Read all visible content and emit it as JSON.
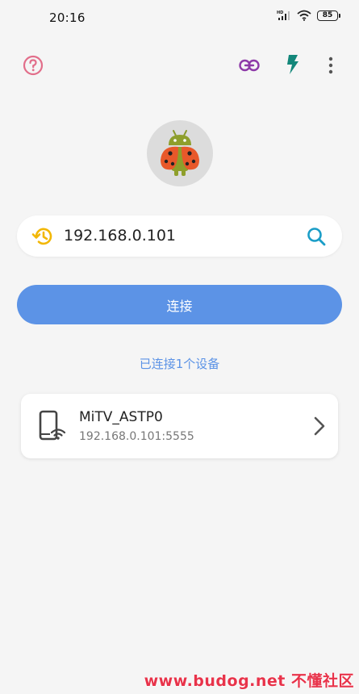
{
  "status_bar": {
    "time": "20:16",
    "network_badge": "HD",
    "battery": "85"
  },
  "toolbar": {
    "icons": [
      "help-icon",
      "link-icon",
      "flash-icon",
      "more-icon"
    ],
    "colors": {
      "help": "#e26e8a",
      "link": "#8e3aa8",
      "flash": "#13877a",
      "more": "#555555"
    }
  },
  "address": {
    "value": "192.168.0.101",
    "icon_left": "history-icon",
    "icon_right": "search-icon",
    "history_color": "#f2b705",
    "search_color": "#1a9dc7"
  },
  "connect_button": {
    "label": "连接",
    "color": "#5c93e6"
  },
  "connected_status": "已连接1个设备",
  "devices": [
    {
      "name": "MiTV_ASTP0",
      "address": "192.168.0.101:5555",
      "icon": "phone-wifi-icon"
    }
  ],
  "watermark": "www.budog.net 不懂社区"
}
